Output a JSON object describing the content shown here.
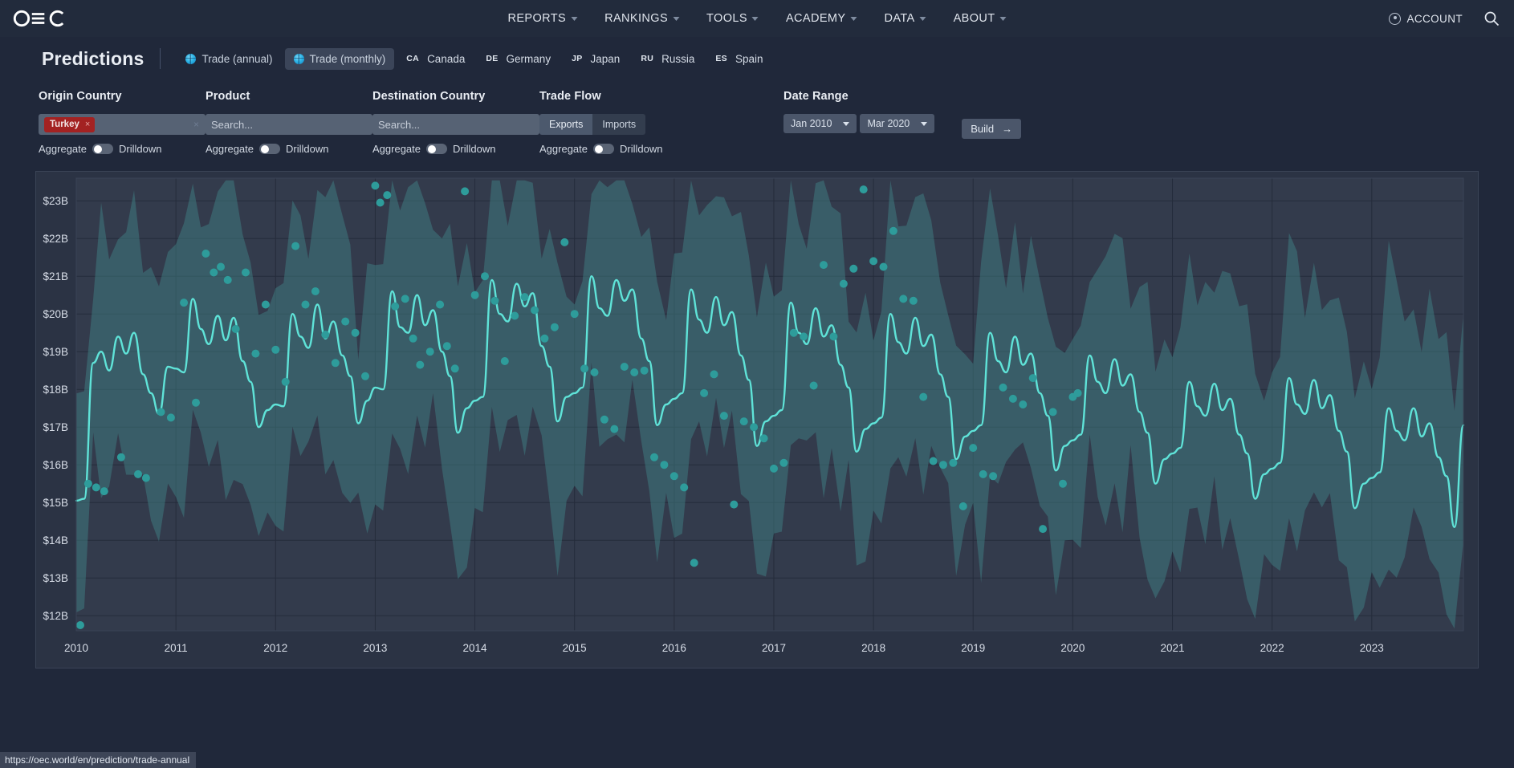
{
  "topnav": {
    "logo_alt": "OEC",
    "links": [
      {
        "label": "REPORTS",
        "has_caret": true
      },
      {
        "label": "RANKINGS",
        "has_caret": true
      },
      {
        "label": "TOOLS",
        "has_caret": true
      },
      {
        "label": "ACADEMY",
        "has_caret": true
      },
      {
        "label": "DATA",
        "has_caret": true
      },
      {
        "label": "ABOUT",
        "has_caret": true
      }
    ],
    "account_label": "ACCOUNT",
    "search_icon": "search-icon"
  },
  "header": {
    "title": "Predictions",
    "tabs": [
      {
        "label": "Trade (annual)",
        "icon": "globe-icon",
        "active": false
      },
      {
        "label": "Trade (monthly)",
        "icon": "globe-icon",
        "active": true
      }
    ],
    "countries": [
      {
        "code": "CA",
        "name": "Canada"
      },
      {
        "code": "DE",
        "name": "Germany"
      },
      {
        "code": "JP",
        "name": "Japan"
      },
      {
        "code": "RU",
        "name": "Russia"
      },
      {
        "code": "ES",
        "name": "Spain"
      }
    ]
  },
  "filters": {
    "origin": {
      "label": "Origin Country",
      "chip": "Turkey",
      "chip_remove": "×",
      "clear": "×",
      "aggregate_label": "Aggregate",
      "drilldown_label": "Drilldown"
    },
    "product": {
      "label": "Product",
      "placeholder": "Search...",
      "aggregate_label": "Aggregate",
      "drilldown_label": "Drilldown"
    },
    "destination": {
      "label": "Destination Country",
      "placeholder": "Search...",
      "aggregate_label": "Aggregate",
      "drilldown_label": "Drilldown"
    },
    "tradeflow": {
      "label": "Trade Flow",
      "exports_label": "Exports",
      "imports_label": "Imports",
      "selected": "Exports",
      "aggregate_label": "Aggregate",
      "drilldown_label": "Drilldown"
    },
    "daterange": {
      "label": "Date Range",
      "start": "Jan 2010",
      "end": "Mar 2020"
    },
    "build": {
      "label": "Build",
      "arrow": "→"
    }
  },
  "statusbar": {
    "url": "https://oec.world/en/prediction/trade-annual"
  },
  "colors": {
    "page_bg": "#20283a",
    "nav_bg": "#222b3c",
    "chart_bg": "#2b3344",
    "accent_line": "#5fe3d8",
    "band_fill": "#3f7f83",
    "dot": "#2e9c9b",
    "chip_red": "#a32222"
  },
  "chart_data": {
    "type": "line",
    "title": "",
    "xlabel": "",
    "ylabel": "",
    "ylim": [
      11600,
      23600
    ],
    "ytick_labels": [
      "$23B",
      "$22B",
      "$21B",
      "$20B",
      "$19B",
      "$18B",
      "$17B",
      "$16B",
      "$15B",
      "$14B",
      "$13B",
      "$12B"
    ],
    "ytick_values": [
      23000,
      22000,
      21000,
      20000,
      19000,
      18000,
      17000,
      16000,
      15000,
      14000,
      13000,
      12000
    ],
    "xtick_labels": [
      "2010",
      "2011",
      "2012",
      "2013",
      "2014",
      "2015",
      "2016",
      "2017",
      "2018",
      "2019",
      "2020",
      "2021",
      "2022",
      "2023"
    ],
    "xlim": [
      2010.0,
      2023.92
    ],
    "grid": true,
    "legend": "none",
    "units": "USD",
    "series": [
      {
        "name": "prediction",
        "kind": "line",
        "color": "#5fe3d8",
        "x": [
          2010.0,
          2010.08,
          2010.17,
          2010.25,
          2010.33,
          2010.42,
          2010.5,
          2010.58,
          2010.67,
          2010.75,
          2010.83,
          2010.92,
          2011.0,
          2011.08,
          2011.17,
          2011.25,
          2011.33,
          2011.42,
          2011.5,
          2011.58,
          2011.67,
          2011.75,
          2011.83,
          2011.92,
          2012.0,
          2012.08,
          2012.17,
          2012.25,
          2012.33,
          2012.42,
          2012.5,
          2012.58,
          2012.67,
          2012.75,
          2012.83,
          2012.92,
          2013.0,
          2013.08,
          2013.17,
          2013.25,
          2013.33,
          2013.42,
          2013.5,
          2013.58,
          2013.67,
          2013.75,
          2013.83,
          2013.92,
          2014.0,
          2014.08,
          2014.17,
          2014.25,
          2014.33,
          2014.42,
          2014.5,
          2014.58,
          2014.67,
          2014.75,
          2014.83,
          2014.92,
          2015.0,
          2015.08,
          2015.17,
          2015.25,
          2015.33,
          2015.42,
          2015.5,
          2015.58,
          2015.67,
          2015.75,
          2015.83,
          2015.92,
          2016.0,
          2016.08,
          2016.17,
          2016.25,
          2016.33,
          2016.42,
          2016.5,
          2016.58,
          2016.67,
          2016.75,
          2016.83,
          2016.92,
          2017.0,
          2017.08,
          2017.17,
          2017.25,
          2017.33,
          2017.42,
          2017.5,
          2017.58,
          2017.67,
          2017.75,
          2017.83,
          2017.92,
          2018.0,
          2018.08,
          2018.17,
          2018.25,
          2018.33,
          2018.42,
          2018.5,
          2018.58,
          2018.67,
          2018.75,
          2018.83,
          2018.92,
          2019.0,
          2019.08,
          2019.17,
          2019.25,
          2019.33,
          2019.42,
          2019.5,
          2019.58,
          2019.67,
          2019.75,
          2019.83,
          2019.92,
          2020.0,
          2020.08,
          2020.17,
          2020.25,
          2020.33,
          2020.42,
          2020.5,
          2020.58,
          2020.67,
          2020.75,
          2020.83,
          2020.92,
          2021.0,
          2021.08,
          2021.17,
          2021.25,
          2021.33,
          2021.42,
          2021.5,
          2021.58,
          2021.67,
          2021.75,
          2021.83,
          2021.92,
          2022.0,
          2022.08,
          2022.17,
          2022.25,
          2022.33,
          2022.42,
          2022.5,
          2022.58,
          2022.67,
          2022.75,
          2022.83,
          2022.92,
          2023.0,
          2023.08,
          2023.17,
          2023.25,
          2023.33,
          2023.42,
          2023.5,
          2023.58,
          2023.67,
          2023.75,
          2023.83,
          2023.92
        ],
        "values": [
          15050,
          15100,
          18700,
          19000,
          18500,
          19400,
          18950,
          19500,
          18400,
          17900,
          17350,
          18600,
          18550,
          18450,
          20400,
          19600,
          19200,
          19950,
          19300,
          19900,
          18750,
          18200,
          17000,
          17450,
          17600,
          17550,
          20000,
          19400,
          19100,
          20250,
          19350,
          19800,
          18900,
          18350,
          17100,
          17700,
          18050,
          18000,
          20600,
          19650,
          19500,
          20500,
          19700,
          20100,
          19000,
          18350,
          16850,
          17500,
          17700,
          17800,
          20900,
          20000,
          19800,
          20800,
          20200,
          20550,
          19150,
          18600,
          17150,
          17800,
          17900,
          18050,
          21000,
          20150,
          19950,
          20900,
          20350,
          20650,
          19350,
          18750,
          17050,
          17600,
          17750,
          17900,
          20650,
          19850,
          19500,
          20450,
          19700,
          20050,
          18900,
          18250,
          16500,
          17150,
          17300,
          17450,
          20300,
          19500,
          19200,
          20150,
          19400,
          19700,
          18650,
          18050,
          16350,
          16950,
          17100,
          17250,
          20000,
          19250,
          18950,
          19900,
          19150,
          19450,
          18400,
          17800,
          16150,
          16750,
          16900,
          17050,
          19500,
          18750,
          18450,
          19400,
          18650,
          18950,
          17900,
          17300,
          15850,
          16500,
          16650,
          16800,
          18900,
          18200,
          17900,
          18800,
          18100,
          18400,
          17400,
          16850,
          15500,
          16150,
          16300,
          16450,
          18200,
          17550,
          17300,
          18150,
          17450,
          17750,
          16800,
          16300,
          15100,
          15750,
          15900,
          16050,
          18300,
          17600,
          17350,
          18250,
          17500,
          17850,
          16900,
          16350,
          14850,
          15500,
          15650,
          15800,
          17500,
          16900,
          16650,
          17500,
          16750,
          17100,
          16200,
          15700,
          14350,
          17050
        ]
      },
      {
        "name": "confidence_band",
        "kind": "band",
        "color": "#3f7f83",
        "note": "shaded upper/lower prediction interval, roughly +/- 3B around prediction, jagged monthly"
      },
      {
        "name": "observed",
        "kind": "scatter",
        "color": "#2e9c9b",
        "points": [
          [
            2010.04,
            11750
          ],
          [
            2010.12,
            15500
          ],
          [
            2010.2,
            15400
          ],
          [
            2010.28,
            15300
          ],
          [
            2010.45,
            16200
          ],
          [
            2010.62,
            15750
          ],
          [
            2010.7,
            15650
          ],
          [
            2010.85,
            17400
          ],
          [
            2010.95,
            17250
          ],
          [
            2011.08,
            20300
          ],
          [
            2011.2,
            17650
          ],
          [
            2011.3,
            21600
          ],
          [
            2011.38,
            21100
          ],
          [
            2011.45,
            21250
          ],
          [
            2011.52,
            20900
          ],
          [
            2011.6,
            19600
          ],
          [
            2011.7,
            21100
          ],
          [
            2011.8,
            18950
          ],
          [
            2011.9,
            20250
          ],
          [
            2012.0,
            19050
          ],
          [
            2012.1,
            18200
          ],
          [
            2012.2,
            21800
          ],
          [
            2012.3,
            20250
          ],
          [
            2012.4,
            20600
          ],
          [
            2012.5,
            19450
          ],
          [
            2012.6,
            18700
          ],
          [
            2012.7,
            19800
          ],
          [
            2012.8,
            19500
          ],
          [
            2012.9,
            18350
          ],
          [
            2013.0,
            23400
          ],
          [
            2013.05,
            22950
          ],
          [
            2013.12,
            23150
          ],
          [
            2013.2,
            20200
          ],
          [
            2013.3,
            20400
          ],
          [
            2013.38,
            19350
          ],
          [
            2013.45,
            18650
          ],
          [
            2013.55,
            19000
          ],
          [
            2013.65,
            20250
          ],
          [
            2013.72,
            19150
          ],
          [
            2013.8,
            18550
          ],
          [
            2013.9,
            23250
          ],
          [
            2014.0,
            20500
          ],
          [
            2014.1,
            21000
          ],
          [
            2014.2,
            20350
          ],
          [
            2014.3,
            18750
          ],
          [
            2014.4,
            19950
          ],
          [
            2014.5,
            20450
          ],
          [
            2014.6,
            20100
          ],
          [
            2014.7,
            19350
          ],
          [
            2014.8,
            19650
          ],
          [
            2014.9,
            21900
          ],
          [
            2015.0,
            20000
          ],
          [
            2015.1,
            18550
          ],
          [
            2015.2,
            18450
          ],
          [
            2015.3,
            17200
          ],
          [
            2015.4,
            16950
          ],
          [
            2015.5,
            18600
          ],
          [
            2015.6,
            18450
          ],
          [
            2015.7,
            18500
          ],
          [
            2015.8,
            16200
          ],
          [
            2015.9,
            16000
          ],
          [
            2016.0,
            15700
          ],
          [
            2016.1,
            15400
          ],
          [
            2016.2,
            13400
          ],
          [
            2016.3,
            17900
          ],
          [
            2016.4,
            18400
          ],
          [
            2016.5,
            17300
          ],
          [
            2016.6,
            14950
          ],
          [
            2016.7,
            17150
          ],
          [
            2016.8,
            17000
          ],
          [
            2016.9,
            16700
          ],
          [
            2017.0,
            15900
          ],
          [
            2017.1,
            16050
          ],
          [
            2017.2,
            19500
          ],
          [
            2017.3,
            19400
          ],
          [
            2017.4,
            18100
          ],
          [
            2017.5,
            21300
          ],
          [
            2017.6,
            19400
          ],
          [
            2017.7,
            20800
          ],
          [
            2017.8,
            21200
          ],
          [
            2017.9,
            23300
          ],
          [
            2018.0,
            21400
          ],
          [
            2018.1,
            21250
          ],
          [
            2018.2,
            22200
          ],
          [
            2018.3,
            20400
          ],
          [
            2018.4,
            20350
          ],
          [
            2018.5,
            17800
          ],
          [
            2018.6,
            16100
          ],
          [
            2018.7,
            16000
          ],
          [
            2018.8,
            16050
          ],
          [
            2018.9,
            14900
          ],
          [
            2019.0,
            16450
          ],
          [
            2019.1,
            15750
          ],
          [
            2019.2,
            15700
          ],
          [
            2019.3,
            18050
          ],
          [
            2019.4,
            17750
          ],
          [
            2019.5,
            17600
          ],
          [
            2019.6,
            18300
          ],
          [
            2019.7,
            14300
          ],
          [
            2019.8,
            17400
          ],
          [
            2019.9,
            15500
          ],
          [
            2020.0,
            17800
          ],
          [
            2020.05,
            17900
          ]
        ]
      }
    ]
  }
}
